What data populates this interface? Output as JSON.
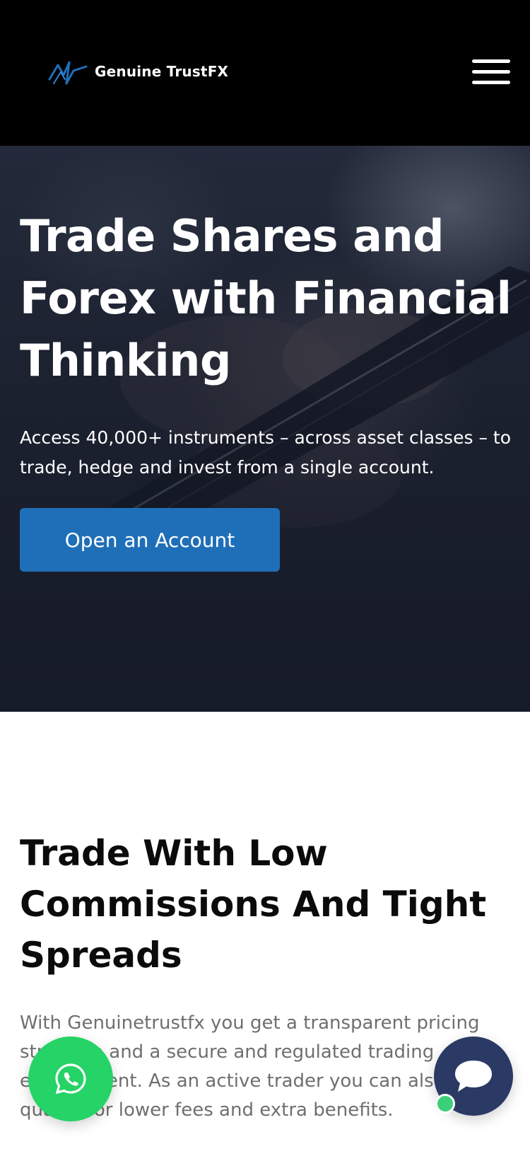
{
  "header": {
    "brand": "Genuine TrustFX",
    "logo_icon": "trustfx-logo-icon",
    "menu_icon": "hamburger-menu-icon"
  },
  "hero": {
    "title": "Trade Shares and Forex with Financial Thinking",
    "subtitle": "Access 40,000+ instruments – across asset classes – to trade, hedge and invest from a single account.",
    "cta_label": "Open an Account"
  },
  "section2": {
    "title": "Trade With Low Commissions And Tight Spreads",
    "text": "With Genuinetrustfx you get a transparent pricing structure and a secure and regulated trading environment. As an active trader you can also qualify for lower fees and extra benefits."
  },
  "floating": {
    "whatsapp_icon": "whatsapp-icon",
    "chat_icon": "chat-bubble-icon"
  },
  "colors": {
    "header_bg": "#000000",
    "cta": "#1f6fb8",
    "whatsapp": "#25d366",
    "chat": "#2b3a64",
    "online": "#3ad07a"
  }
}
